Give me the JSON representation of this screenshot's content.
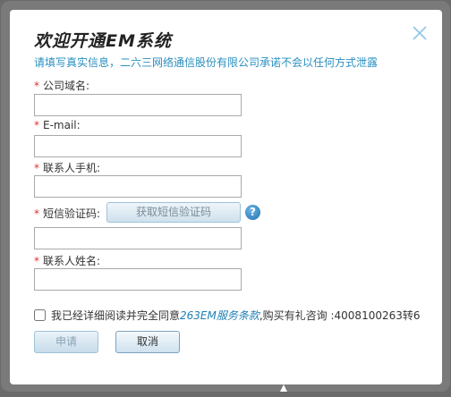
{
  "dialog": {
    "title": "欢迎开通EM系统",
    "notice": "请填写真实信息，二六三网络通信股份有限公司承诺不会以任何方式泄露",
    "close_icon": "close-icon"
  },
  "form": {
    "required_mark": "*",
    "domain_label": "公司域名:",
    "domain_value": "",
    "email_label": "E-mail:",
    "email_value": "",
    "phone_label": "联系人手机:",
    "phone_value": "",
    "sms_label": "短信验证码:",
    "sms_button": "获取短信验证码",
    "help_icon": "?",
    "sms_value": "",
    "name_label": "联系人姓名:",
    "name_value": ""
  },
  "agreement": {
    "checked": false,
    "prefix": "我已经详细阅读并完全同意",
    "link": "263EM服务条款",
    "suffix": ",购买有礼咨询 :4008100263转6"
  },
  "buttons": {
    "submit": "申请",
    "cancel": "取消"
  },
  "colors": {
    "notice": "#2a8fc0",
    "required": "#dd3333",
    "link": "#1f7fb5"
  }
}
